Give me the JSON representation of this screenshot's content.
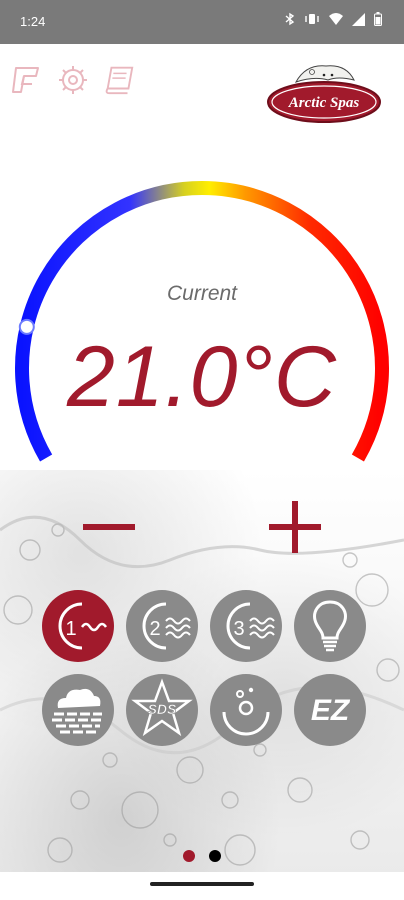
{
  "status": {
    "time": "1:24"
  },
  "toolbar": {
    "items": [
      {
        "icon": "filter-icon"
      },
      {
        "icon": "gear-icon"
      },
      {
        "icon": "manual-icon"
      }
    ]
  },
  "brand": {
    "logo_text": "Arctic Spas"
  },
  "thermostat": {
    "label": "Current",
    "value_text": "21.0°C",
    "value_c": 21.0,
    "knob_position_fraction": 0.18
  },
  "controls": {
    "minus_label": "−",
    "plus_label": "+"
  },
  "modes": [
    {
      "name": "pump-1-icon",
      "label": "1",
      "active": true
    },
    {
      "name": "pump-2-icon",
      "label": "2",
      "active": false
    },
    {
      "name": "pump-3-icon",
      "label": "3",
      "active": false
    },
    {
      "name": "light-bulb-icon",
      "label": "",
      "active": false
    },
    {
      "name": "fog-icon",
      "label": "",
      "active": false
    },
    {
      "name": "sds-icon",
      "label": "SDS",
      "active": false
    },
    {
      "name": "bubble-icon",
      "label": "",
      "active": false
    },
    {
      "name": "ez-icon",
      "label": "EZ",
      "active": false
    }
  ],
  "pager": {
    "pages": 2,
    "current": 1
  },
  "colors": {
    "accent": "#a11a2c",
    "button_gray": "#8a8a8a",
    "label_gray": "#6b6b6b"
  }
}
